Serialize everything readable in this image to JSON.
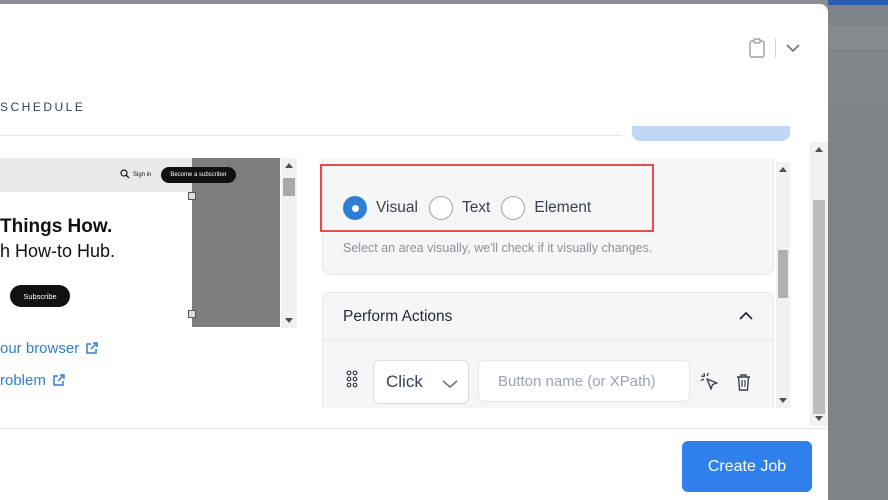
{
  "header": {
    "tab_label": "SCHEDULE",
    "icons": [
      "clipboard-icon",
      "chevron-down-icon"
    ]
  },
  "preview": {
    "nav_signin": "Sign in",
    "nav_subscriber_button": "Become a subscriber",
    "headline": "Things How.",
    "subheadline": "h How-to Hub.",
    "subscribe_button": "Subscribe"
  },
  "links": {
    "browser_link": "our browser",
    "problem_link": "roblem"
  },
  "monitor_type": {
    "options": [
      {
        "label": "Visual",
        "selected": true
      },
      {
        "label": "Text",
        "selected": false
      },
      {
        "label": "Element",
        "selected": false
      }
    ],
    "hint": "Select an area visually, we'll check if it visually changes."
  },
  "actions": {
    "title": "Perform Actions",
    "action_select_value": "Click",
    "target_placeholder": "Button name (or XPath)"
  },
  "footer": {
    "create_button": "Create Job"
  },
  "colors": {
    "accent": "#2f80ed",
    "highlight": "#e74c4c"
  }
}
